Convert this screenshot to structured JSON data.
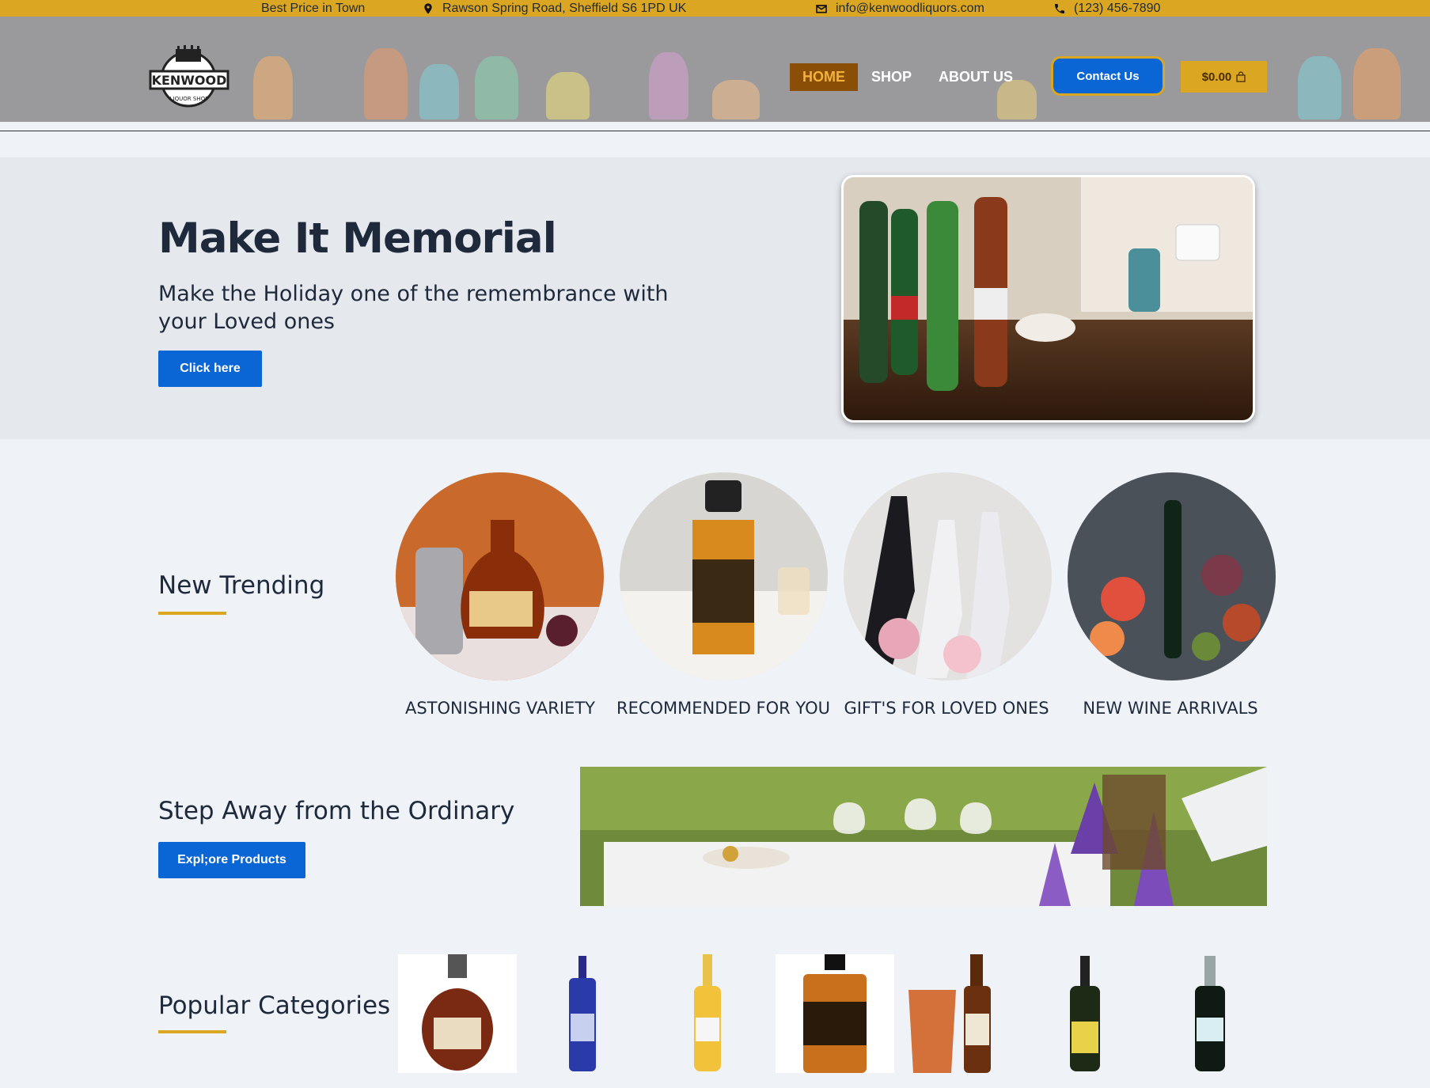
{
  "topbar": {
    "tagline": "Best Price in Town",
    "address": "Rawson Spring Road, Sheffield S6 1PD UK",
    "email": "info@kenwoodliquors.com",
    "phone": "(123) 456-7890"
  },
  "header": {
    "logo_text": "KENWOOD",
    "logo_sub": "LIQUOR SHOP",
    "nav": [
      "HOME",
      "SHOP",
      "ABOUT US"
    ],
    "contact_label": "Contact Us",
    "cart_total": "$0.00"
  },
  "hero": {
    "title": "Make It Memorial",
    "subtitle": "Make the Holiday one of the remembrance with your Loved ones",
    "button": "Click here"
  },
  "trending": {
    "title": "New Trending",
    "items": [
      "ASTONISHING VARIETY",
      "RECOMMENDED FOR YOU",
      "GIFT'S FOR LOVED ONES",
      "NEW WINE ARRIVALS"
    ]
  },
  "step": {
    "title": "Step Away from the Ordinary",
    "button": "Expl;ore Products"
  },
  "popular": {
    "title": "Popular Categories"
  },
  "colors": {
    "accent": "#dba621",
    "primary": "#0a66d4",
    "nav_active_bg": "#8b4e06"
  }
}
